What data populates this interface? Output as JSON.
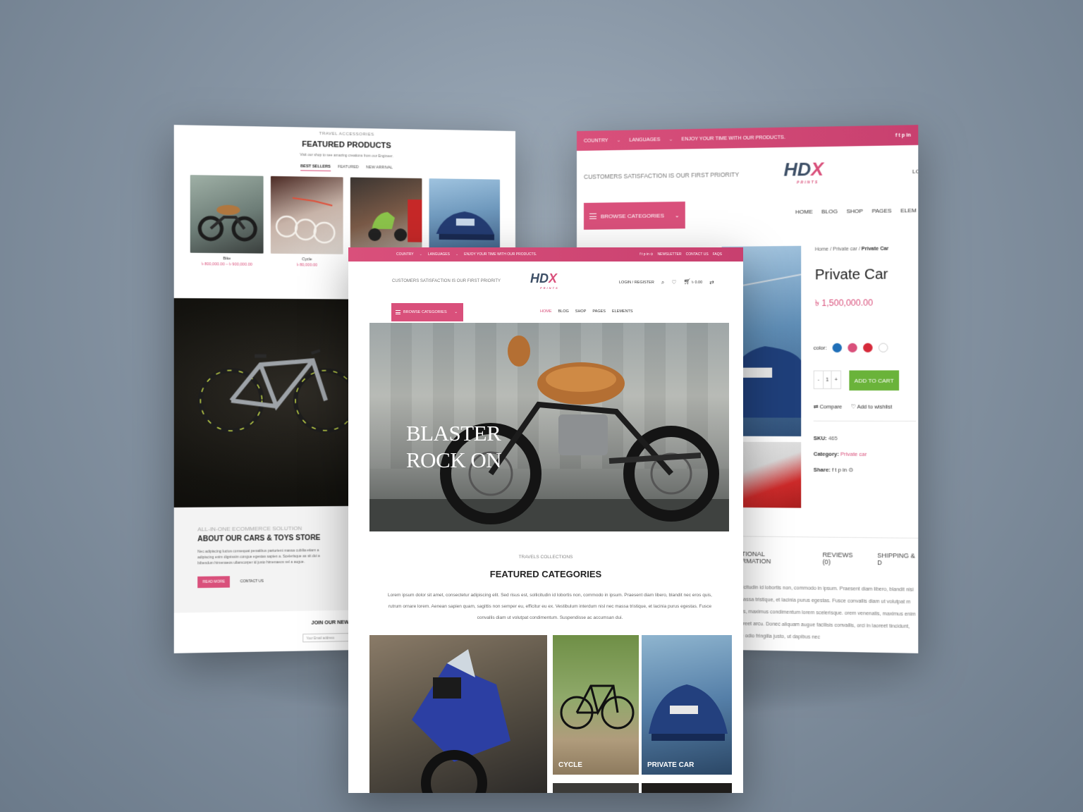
{
  "left": {
    "eyebrow": "TRAVEL ACCESSORIES",
    "title": "FEATURED PRODUCTS",
    "subtitle": "Visit our shop to see amazing creations from our Engineer.",
    "tabs": [
      "BEST SELLERS",
      "FEATURED",
      "NEW ARRIVAL"
    ],
    "products": [
      {
        "name": "Bike",
        "price": "৳ 800,000.00 – ৳ 900,000.00"
      },
      {
        "name": "Cycle",
        "price": "৳ 80,000.00"
      },
      {
        "name": "",
        "price": ""
      },
      {
        "name": "",
        "price": ""
      }
    ],
    "about": {
      "eyebrow": "ALL-IN-ONE ECOMMERCE SOLUTION",
      "title": "ABOUT OUR CARS & TOYS STORE",
      "text": "Nec adipiscing luctus consequat penatibus parturient massa cubilia etiam a adipiscing enim dignissim congue egestas sapien a. Scelerisque as sit dui a bibendum himenaeos ullamcorper id justo himenaeos vel a augue.",
      "read_more": "READ MORE",
      "contact": "CONTACT US"
    },
    "newsletter": {
      "title": "JOIN OUR NEWS",
      "placeholder": "Your Email address"
    }
  },
  "right": {
    "topbar": {
      "country": "COUNTRY",
      "languages": "LANGUAGES",
      "message": "ENJOY YOUR TIME WITH OUR PRODUCTS.",
      "social": "f  t  p  in"
    },
    "tagline": "CUSTOMERS SATISFACTION IS OUR FIRST PRIORITY",
    "logo": {
      "main": "HD",
      "x": "X",
      "sub": "PRINTS"
    },
    "login_partial": "LO",
    "browse": "BROWSE CATEGORIES",
    "nav": [
      "HOME",
      "BLOG",
      "SHOP",
      "PAGES",
      "ELEM"
    ],
    "breadcrumb": {
      "home": "Home",
      "cat": "Private car",
      "current": "Private Car"
    },
    "product_title": "Private Car",
    "price": "৳ 1,500,000.00",
    "color_label": "color:",
    "colors": [
      "#1f6fb8",
      "#d9507b",
      "#d62a3a",
      "#ffffff"
    ],
    "qty": {
      "minus": "-",
      "value": "1",
      "plus": "+"
    },
    "add_to_cart": "ADD TO CART",
    "compare": "Compare",
    "wishlist": "Add to wishlist",
    "sku_label": "SKU:",
    "sku": "465",
    "category_label": "Category:",
    "category": "Private car",
    "share_label": "Share:",
    "share_icons": "f  t  p  in  ⊙",
    "tabs": [
      "ADDITIONAL INFORMATION",
      "REVIEWS (0)",
      "SHIPPING & D"
    ],
    "desc": "s, sollicitudin id lobortis non, commodo in ipsum. Praesent diam libero, blandit nisi nec massa tristique, et lacinia purus egestas. Fusce convallis diam ut volutpat m ultrices, maximus condimentum lorem scelerisque. orem venenatis, maximus enim in, laoreet arcu. Donec aliquam augue facilisis convallis, orci in laoreet tincidunt, neque odio fringilla justo, ut dapibus nec"
  },
  "center": {
    "topbar": {
      "country": "COUNTRY",
      "languages": "LANGUAGES",
      "message": "ENJOY YOUR TIME WITH OUR PRODUCTS.",
      "social": "f  t  p  in  ⊙",
      "newsletter": "NEWSLETTER",
      "contact": "CONTACT US",
      "faqs": "FAQS"
    },
    "tagline": "CUSTOMERS SATISFACTION IS OUR FIRST PRIORITY",
    "logo": {
      "main": "HD",
      "x": "X",
      "sub": "PRINTS"
    },
    "login": "LOGIN / REGISTER",
    "cart_total": "৳ 0.00",
    "browse": "BROWSE CATEGORIES",
    "nav": [
      "HOME",
      "BLOG",
      "SHOP",
      "PAGES",
      "ELEMENTS"
    ],
    "hero": {
      "line1": "BLASTER",
      "line2": "ROCK ON"
    },
    "collections": "TRAVELS COLLECTIONS",
    "featured_title": "FEATURED CATEGORIES",
    "featured_text": "Lorem ipsum dolor sit amet, consectetur adipiscing elit. Sed risus est, sollicitudin id lobortis non, commodo in ipsum. Praesent diam libero, blandit nec eros quis, rutrum ornare lorem. Aenean sapien quam, sagittis non semper eu, efficitur eu ex. Vestibulum interdum nisl nec massa tristique, et lacinia purus egestas. Fusce convallis diam ut volutpat condimentum. Suspendisse ac accumsan dui.",
    "categories": [
      "",
      "CYCLE",
      "PRIVATE CAR"
    ]
  }
}
